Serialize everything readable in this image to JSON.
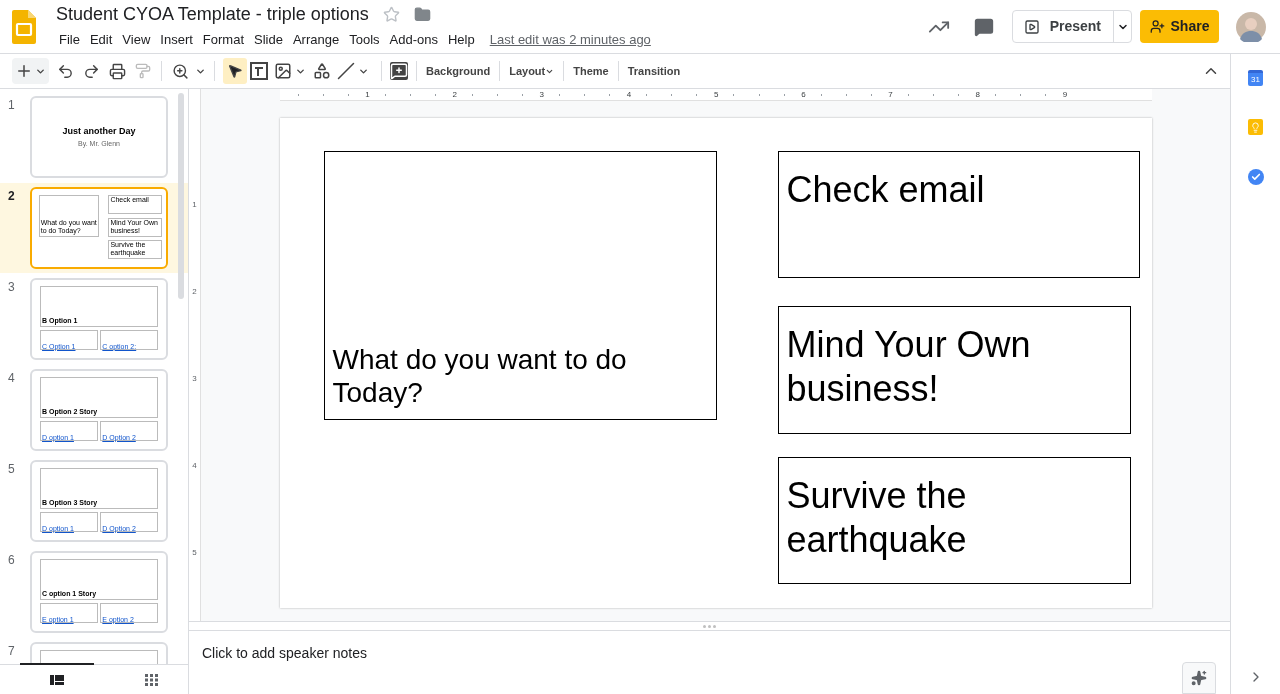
{
  "document": {
    "title": "Student CYOA Template - triple options",
    "starred": false
  },
  "menu": [
    "File",
    "Edit",
    "View",
    "Insert",
    "Format",
    "Slide",
    "Arrange",
    "Tools",
    "Add-ons",
    "Help"
  ],
  "last_edit": "Last edit was 2 minutes ago",
  "present_button": "Present",
  "share_button": "Share",
  "tools": [
    {
      "kind": "select",
      "selected": true
    },
    {
      "kind": "textbox",
      "selected": false
    },
    {
      "kind": "image",
      "selected": false
    },
    {
      "kind": "shape",
      "selected": false
    },
    {
      "kind": "line",
      "selected": false
    }
  ],
  "toolbar_buttons": [
    {
      "label": "Background",
      "dropdown": false
    },
    {
      "label": "Layout",
      "dropdown": true
    },
    {
      "label": "Theme",
      "dropdown": false
    },
    {
      "label": "Transition",
      "dropdown": false
    }
  ],
  "slides": [
    {
      "number": "1",
      "selected": false,
      "kind": "title",
      "title": "Just another Day",
      "subtitle": "By. Mr. Glenn"
    },
    {
      "number": "2",
      "selected": true,
      "kind": "choice",
      "prompt": "What do you want to do Today?",
      "options": [
        "Check email",
        "Mind Your Own business!",
        "Survive the earthquake"
      ]
    },
    {
      "number": "3",
      "selected": false,
      "kind": "story",
      "heading": "B Option 1",
      "links": [
        "C Option 1",
        "C option 2:"
      ]
    },
    {
      "number": "4",
      "selected": false,
      "kind": "story",
      "heading": "B Option 2 Story",
      "links": [
        "D option 1",
        "D Option 2"
      ]
    },
    {
      "number": "5",
      "selected": false,
      "kind": "story",
      "heading": "B Option 3 Story",
      "links": [
        "D option 1",
        "D Option 2"
      ]
    },
    {
      "number": "6",
      "selected": false,
      "kind": "story",
      "heading": "C option 1 Story",
      "links": [
        "E option 1",
        "E option 2"
      ]
    },
    {
      "number": "7",
      "selected": false,
      "kind": "partial"
    }
  ],
  "view_tabs": [
    {
      "kind": "list",
      "selected": true
    },
    {
      "kind": "grid",
      "selected": false
    }
  ],
  "ruler": {
    "horizontal": [
      "1",
      "2",
      "3",
      "4",
      "5",
      "6",
      "7",
      "8",
      "9"
    ],
    "vertical": [
      "1",
      "2",
      "3",
      "4",
      "5"
    ]
  },
  "canvas": {
    "prompt": "What do you want to do Today?",
    "options": [
      "Check email",
      "Mind Your Own business!",
      "Survive the earthquake"
    ]
  },
  "notes_placeholder": "Click to add speaker notes",
  "calendar_day": "31"
}
